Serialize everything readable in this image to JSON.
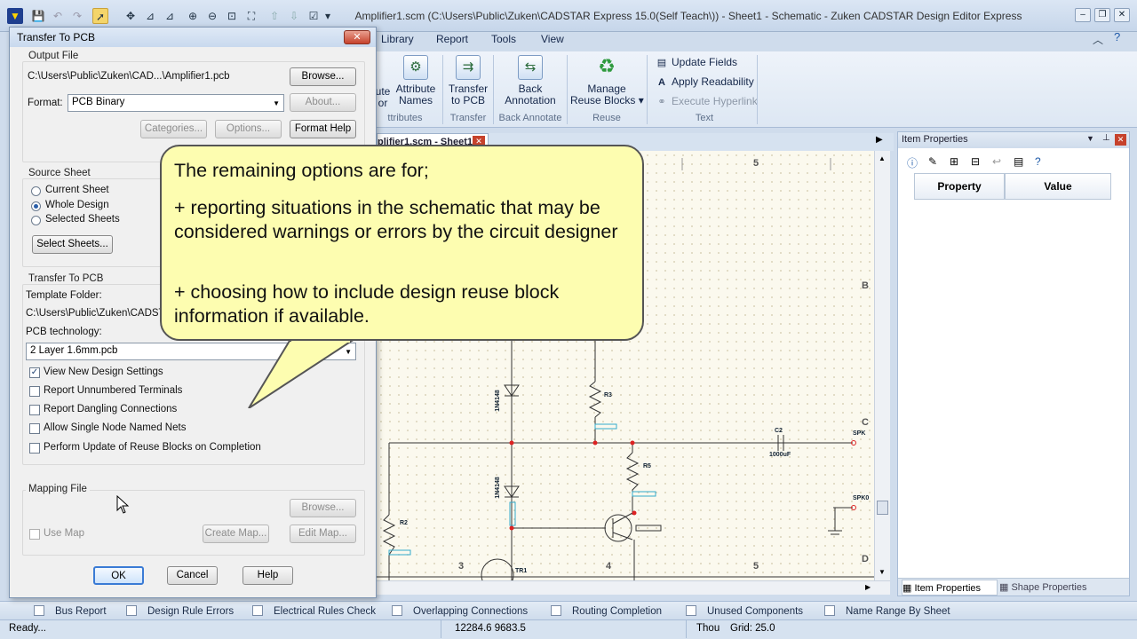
{
  "window": {
    "title": "Amplifier1.scm (C:\\Users\\Public\\Zuken\\CADSTAR Express 15.0(Self Teach\\)) - Sheet1 - Schematic - Zuken CADSTAR Design Editor Express",
    "controls": {
      "min": "–",
      "max": "❐",
      "close": "✕"
    }
  },
  "ribbon": {
    "tabs": [
      "Library",
      "Report",
      "Tools",
      "View"
    ],
    "buttons": {
      "attribute_editor": "ute\nor",
      "attribute_names": "Attribute\nNames",
      "transfer_to_pcb": "Transfer\nto PCB",
      "back_annotation": "Back\nAnnotation",
      "manage_reuse": "Manage\nReuse Blocks ▾",
      "update_fields": "Update Fields",
      "apply_readability": "Apply Readability",
      "execute_hyperlink": "Execute Hyperlink"
    },
    "groups": {
      "attributes": "ttributes",
      "transfer": "Transfer",
      "back_annotate": "Back Annotate",
      "reuse": "Reuse",
      "text": "Text"
    }
  },
  "document_tab": "plifier1.scm - Sheet1",
  "schematic": {
    "col_labels": [
      "5",
      "3",
      "4",
      "5"
    ],
    "row_labels": [
      "B",
      "C",
      "D"
    ],
    "parts": {
      "c2": "C2",
      "c2_val": "1000uF",
      "spk": "SPK",
      "spk0": "SPK0",
      "r3": "R3",
      "r2": "R2",
      "r5": "R5",
      "d1": "1N4148",
      "d2": "1N4148",
      "tr1": "TR1"
    }
  },
  "item_properties": {
    "title": "Item Properties",
    "columns": [
      "Property",
      "Value"
    ],
    "tabs": [
      "Item Properties",
      "Shape Properties"
    ]
  },
  "bottom_tabs": [
    "Bus Report",
    "Design Rule Errors",
    "Electrical Rules Check",
    "Overlapping Connections",
    "Routing Completion",
    "Unused Components",
    "Name Range By Sheet"
  ],
  "status": {
    "ready": "Ready...",
    "coords": "12284.6  9683.5",
    "units": "Thou",
    "grid": "Grid: 25.0"
  },
  "dialog": {
    "title": "Transfer To PCB",
    "close": "✕",
    "output_file": {
      "label": "Output File",
      "path": "C:\\Users\\Public\\Zuken\\CAD...\\Amplifier1.pcb",
      "browse": "Browse...",
      "format_label": "Format:",
      "format_value": "PCB Binary",
      "about": "About...",
      "categories": "Categories...",
      "options": "Options...",
      "format_help": "Format Help"
    },
    "source_sheet": {
      "label": "Source Sheet",
      "options": [
        "Current Sheet",
        "Whole Design",
        "Selected Sheets"
      ],
      "selected": "Whole Design",
      "select_sheets": "Select Sheets..."
    },
    "transfer": {
      "label": "Transfer To PCB",
      "template_label": "Template Folder:",
      "template_path": "C:\\Users\\Public\\Zuken\\CADST",
      "tech_label": "PCB technology:",
      "tech_value": "2 Layer 1.6mm.pcb",
      "checks": [
        {
          "label": "View New Design Settings",
          "checked": true
        },
        {
          "label": "Report Unnumbered Terminals",
          "checked": false
        },
        {
          "label": "Report Dangling Connections",
          "checked": false
        },
        {
          "label": "Allow Single Node Named Nets",
          "checked": false
        },
        {
          "label": "Perform Update of Reuse Blocks on Completion",
          "checked": false
        }
      ]
    },
    "mapping": {
      "label": "Mapping File",
      "browse": "Browse...",
      "use_map": "Use Map",
      "create_map": "Create Map...",
      "edit_map": "Edit Map..."
    },
    "ok": "OK",
    "cancel": "Cancel",
    "help": "Help"
  },
  "callout": {
    "line1": "The remaining options are for;",
    "line2": "+  reporting situations in the schematic that may be considered warnings or errors by the circuit designer",
    "line3": "+ choosing how to include design reuse block information if available."
  }
}
